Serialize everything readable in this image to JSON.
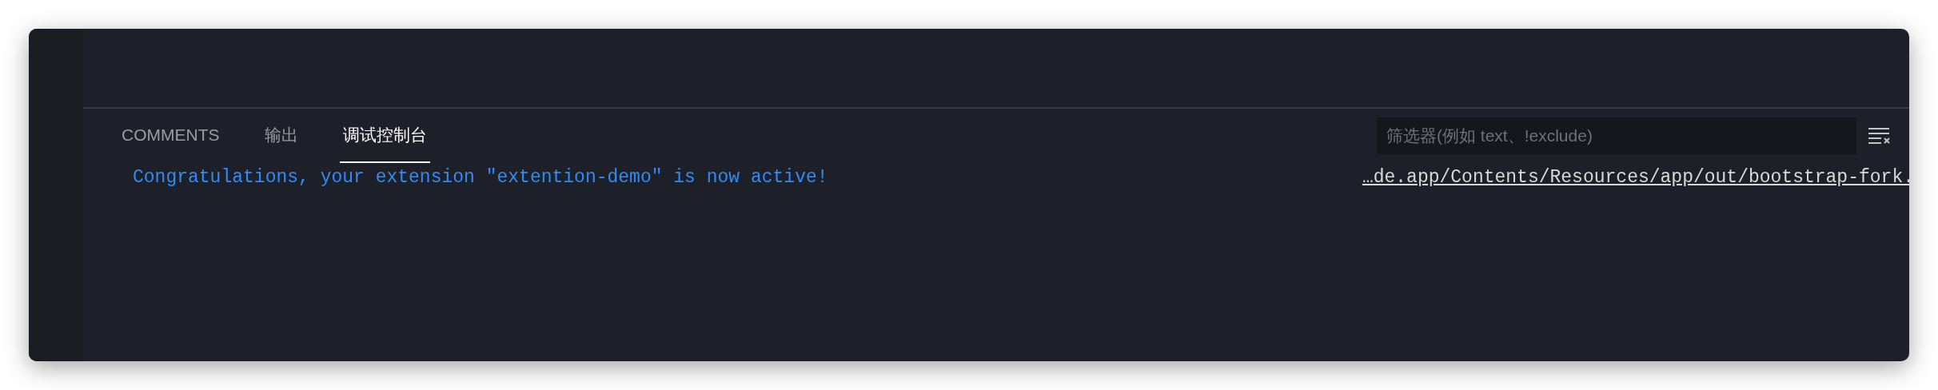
{
  "panel": {
    "tabs": [
      {
        "label": "COMMENTS",
        "selected": false
      },
      {
        "label": "输出",
        "selected": false
      },
      {
        "label": "调试控制台",
        "selected": true
      }
    ],
    "filter": {
      "placeholder": "筛选器(例如 text、!exclude)"
    },
    "console_lines": [
      {
        "message": "Congratulations, your extension \"extention-demo\" is now active!",
        "source": "…de.app/Contents/Resources/app/out/bootstrap-fork."
      }
    ]
  }
}
